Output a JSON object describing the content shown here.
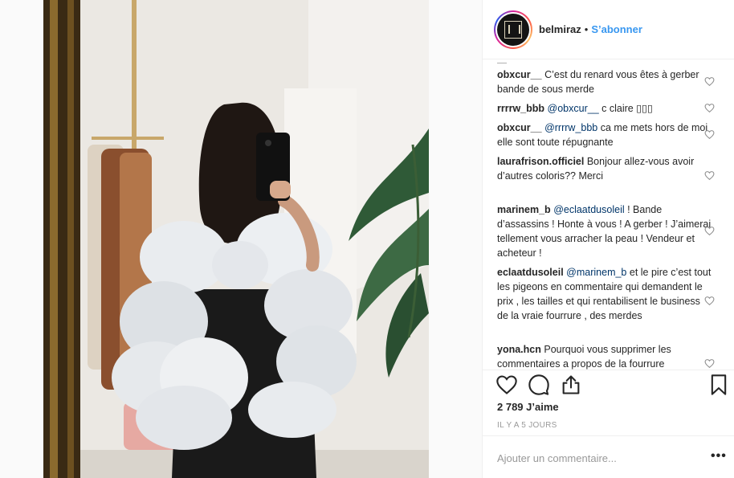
{
  "post": {
    "username": "belmiraz",
    "follow_label": "S’abonner",
    "separator": "•",
    "photo_alt": "Photo",
    "likes_text": "2 789 J’aime",
    "timestamp": "IL Y A 5 JOURS",
    "add_comment_placeholder": "Ajouter un commentaire...",
    "more_label": "•••"
  },
  "comments": [
    {
      "user": "obxcur__",
      "mention": "",
      "text": "C’est du renard vous êtes à gerber bande de sous merde"
    },
    {
      "user": "rrrrw_bbb",
      "mention": "@obxcur__",
      "text": "c claire ▯▯▯"
    },
    {
      "user": "obxcur__",
      "mention": "@rrrrw_bbb",
      "text": "ca me mets hors de moi elle sont toute répugnante"
    },
    {
      "user": "laurafrison.officiel",
      "mention": "",
      "text": "Bonjour allez-vous avoir d’autres coloris?? Merci"
    },
    {
      "user": "marinem_b",
      "mention": "@eclaatdusoleil",
      "text": "! Bande d’assassins ! Honte à vous ! A gerber ! J’aimerai tellement vous arracher la peau ! Vendeur et acheteur !"
    },
    {
      "user": "eclaatdusoleil",
      "mention": "@marinem_b",
      "text": "et le pire c’est tout les pigeons en commentaire qui demandent le prix , les tailles et qui rentabilisent le business de la vraie fourrure , des merdes"
    },
    {
      "user": "yona.hcn",
      "mention": "",
      "text": "Pourquoi vous supprimer les commentaires a propos de la fourrure"
    }
  ],
  "icons": {
    "like": "heart-icon",
    "comment": "comment-bubble-icon",
    "share": "share-icon",
    "save": "bookmark-icon",
    "comment_like": "heart-outline-icon",
    "more": "ellipsis-icon"
  }
}
